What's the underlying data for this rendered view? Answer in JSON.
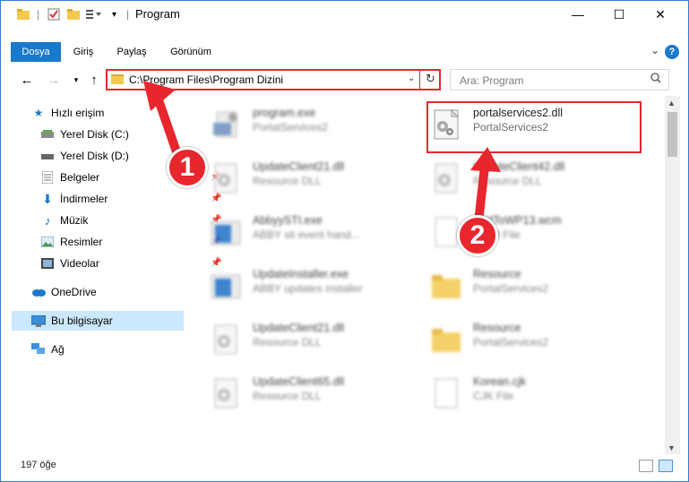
{
  "window": {
    "title": "Program"
  },
  "ribbon": {
    "tabs": [
      "Dosya",
      "Giriş",
      "Paylaş",
      "Görünüm"
    ],
    "help": "?"
  },
  "address": {
    "path": "C:\\Program Files\\Program Dizini"
  },
  "search": {
    "placeholder": "Ara: Program"
  },
  "sidebar": {
    "items": [
      {
        "label": "Hızlı erişim",
        "icon": "star-icon"
      },
      {
        "label": "Yerel Disk (C:)",
        "icon": "drive-icon"
      },
      {
        "label": "Yerel Disk (D:)",
        "icon": "drive-icon"
      },
      {
        "label": "Belgeler",
        "icon": "documents-icon"
      },
      {
        "label": "İndirmeler",
        "icon": "download-icon"
      },
      {
        "label": "Müzik",
        "icon": "music-icon"
      },
      {
        "label": "Resimler",
        "icon": "pictures-icon"
      },
      {
        "label": "Videolar",
        "icon": "video-icon"
      },
      {
        "label": "OneDrive",
        "icon": "cloud-icon"
      },
      {
        "label": "Bu bilgisayar",
        "icon": "computer-icon"
      },
      {
        "label": "Ağ",
        "icon": "network-icon"
      }
    ]
  },
  "files": [
    {
      "name": "program.exe",
      "sub": "PortalServices2",
      "icon": "setup-icon"
    },
    {
      "name": "portalservices2.dll",
      "sub": "PortalServices2",
      "icon": "dll-gear-icon"
    },
    {
      "name": "UpdateClient21.dll",
      "sub": "Resource DLL",
      "icon": "dll-gear-icon"
    },
    {
      "name": "UpdateClient42.dll",
      "sub": "Resource DLL",
      "icon": "dll-gear-icon"
    },
    {
      "name": "AbbyySTI.exe",
      "sub": "ABBY sti event hand...",
      "icon": "exe-icon"
    },
    {
      "name": "AddToWP13.wcm",
      "sub": "WCM File",
      "icon": "file-icon"
    },
    {
      "name": "UpdateInstaller.exe",
      "sub": "ABBY updates installer",
      "icon": "exe-icon"
    },
    {
      "name": "Resource",
      "sub": "PortalServices2",
      "icon": "folder-icon"
    },
    {
      "name": "UpdateClient21.dll",
      "sub": "Resource DLL",
      "icon": "dll-gear-icon"
    },
    {
      "name": "Resource",
      "sub": "PortalServices2",
      "icon": "folder-icon"
    },
    {
      "name": "UpdateClient65.dll",
      "sub": "Resource DLL",
      "icon": "dll-gear-icon"
    },
    {
      "name": "Korean.cjk",
      "sub": "CJK File",
      "icon": "file-icon"
    }
  ],
  "status": {
    "count": "197 öğe"
  },
  "annotations": {
    "step1": "1",
    "step2": "2"
  },
  "colors": {
    "accent": "#1979ca",
    "annotation": "#e8262e",
    "selected": "#cce8ff"
  }
}
